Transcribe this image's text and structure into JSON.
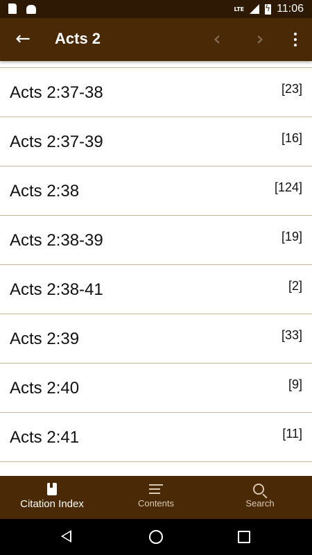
{
  "status_bar": {
    "network": "LTE",
    "time": "11:06"
  },
  "toolbar": {
    "title": "Acts 2"
  },
  "list": {
    "items": [
      {
        "ref": "Acts 2:37-38",
        "count": "[23]"
      },
      {
        "ref": "Acts 2:37-39",
        "count": "[16]"
      },
      {
        "ref": "Acts 2:38",
        "count": "[124]"
      },
      {
        "ref": "Acts 2:38-39",
        "count": "[19]"
      },
      {
        "ref": "Acts 2:38-41",
        "count": "[2]"
      },
      {
        "ref": "Acts 2:39",
        "count": "[33]"
      },
      {
        "ref": "Acts 2:40",
        "count": "[9]"
      },
      {
        "ref": "Acts 2:41",
        "count": "[11]"
      }
    ]
  },
  "bottom_nav": {
    "items": [
      {
        "label": "Citation Index",
        "icon": "book-icon",
        "active": true
      },
      {
        "label": "Contents",
        "icon": "list-icon",
        "active": false
      },
      {
        "label": "Search",
        "icon": "search-icon",
        "active": false
      }
    ]
  },
  "colors": {
    "toolbar": "#4a2907",
    "status_bar": "#2e1a04",
    "divider": "#c9b79c"
  }
}
